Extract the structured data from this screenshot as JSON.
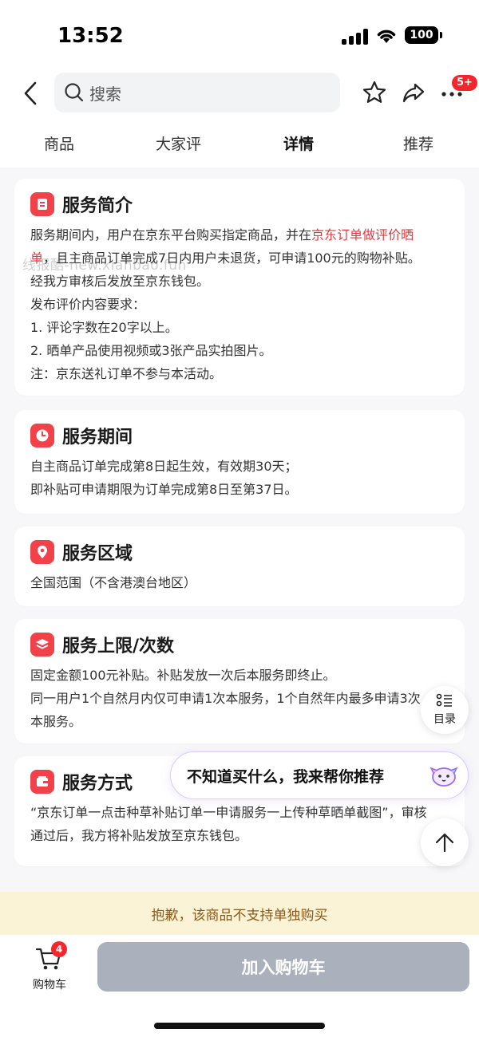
{
  "status": {
    "time": "13:52",
    "battery": "100"
  },
  "nav": {
    "search_placeholder": "搜索",
    "badge": "5+"
  },
  "tabs": [
    {
      "label": "商品"
    },
    {
      "label": "大家评"
    },
    {
      "label": "详情"
    },
    {
      "label": "推荐"
    }
  ],
  "watermark": "线报酷-new.xianbao.fun",
  "cards": {
    "intro": {
      "title": "服务简介",
      "line1_pre": "服务期间内，用户在京东平台购买指定商品，并在",
      "line1_red": "京东订单做评价晒",
      "line2_red": "单",
      "line2_post": "，且主商品订单完成7日内用户未退货，可申请100元的购物补贴。",
      "line3": "经我方审核后发放至京东钱包。",
      "line4": "发布评价内容要求：",
      "line5": " 1. 评论字数在20字以上。",
      "line6": " 2. 晒单产品使用视频或3张产品实拍图片。",
      "line7": "注：京东送礼订单不参与本活动。"
    },
    "period": {
      "title": "服务期间",
      "line1": "自主商品订单完成第8日起生效，有效期30天；",
      "line2": "即补贴可申请期限为订单完成第8日至第37日。"
    },
    "region": {
      "title": "服务区域",
      "line1": "全国范围（不含港澳台地区）"
    },
    "limit": {
      "title": "服务上限/次数",
      "line1": "固定金额100元补贴。补贴发放一次后本服务即终止。",
      "line2": "同一用户1个自然月内仅可申请1次本服务，1个自然年内最多申请3次",
      "line3": "本服务。"
    },
    "method": {
      "title": "服务方式",
      "line1": "“京东订单一点击种草补贴订单一申请服务一上传种草晒单截图”，审核",
      "line2": "通过后，我方将补贴发放至京东钱包。"
    }
  },
  "float": {
    "toc_label": "目录",
    "recommend": "不知道买什么，我来帮你推荐"
  },
  "notice": "抱歉，该商品不支持单独购买",
  "bottom": {
    "cart_label": "购物车",
    "cart_count": "4",
    "add_cart": "加入购物车"
  },
  "colors": {
    "brand_red": "#f1424a",
    "highlight_red": "#e4393c",
    "disabled_button": "#aab0bc",
    "notice_bg": "#fbf3d6"
  }
}
